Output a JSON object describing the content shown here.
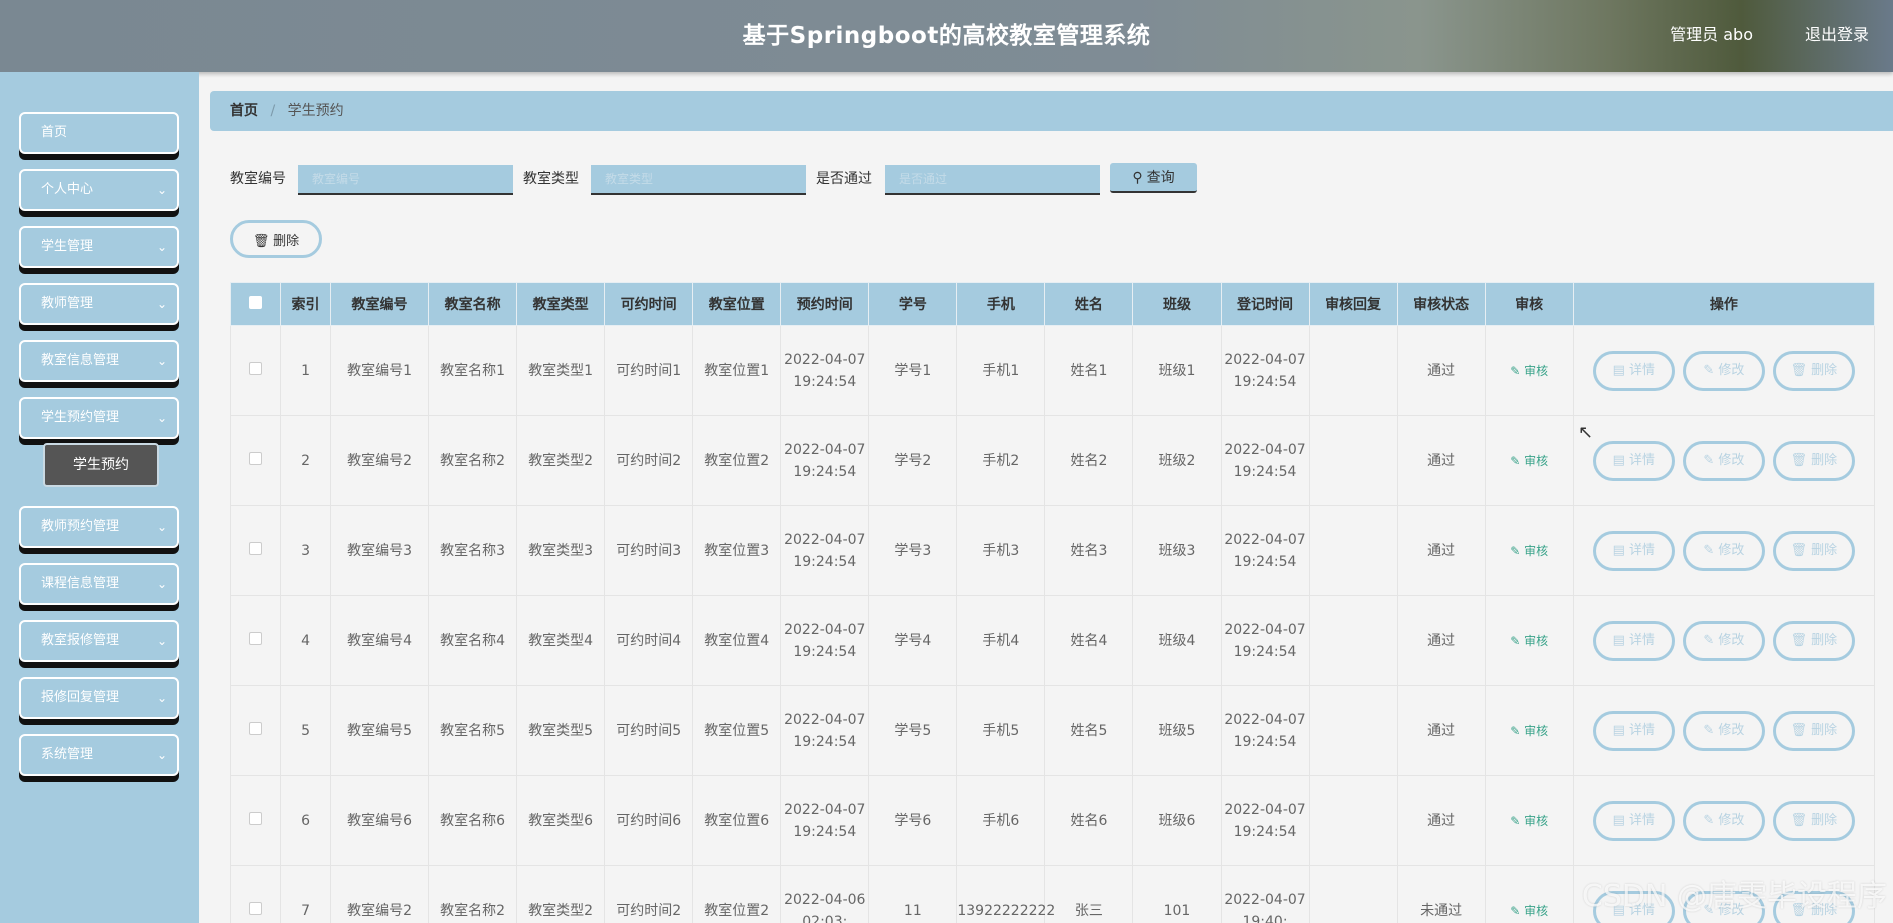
{
  "header": {
    "title": "基于Springboot的高校教室管理系统",
    "user": "管理员 abo",
    "logout": "退出登录"
  },
  "sidebar": {
    "items": [
      {
        "label": "首页",
        "has_chevron": false
      },
      {
        "label": "个人中心",
        "has_chevron": true
      },
      {
        "label": "学生管理",
        "has_chevron": true
      },
      {
        "label": "教师管理",
        "has_chevron": true
      },
      {
        "label": "教室信息管理",
        "has_chevron": true
      },
      {
        "label": "学生预约管理",
        "has_chevron": true
      },
      {
        "label": "教师预约管理",
        "has_chevron": true
      },
      {
        "label": "课程信息管理",
        "has_chevron": true
      },
      {
        "label": "教室报修管理",
        "has_chevron": true
      },
      {
        "label": "报修回复管理",
        "has_chevron": true
      },
      {
        "label": "系统管理",
        "has_chevron": true
      }
    ],
    "sub_item": "学生预约"
  },
  "breadcrumb": {
    "home": "首页",
    "current": "学生预约"
  },
  "search": {
    "field1_label": "教室编号",
    "field1_placeholder": "教室编号",
    "field2_label": "教室类型",
    "field2_placeholder": "教室类型",
    "field3_label": "是否通过",
    "field3_placeholder": "是否通过",
    "button": "查询"
  },
  "delete_button": "删除",
  "table": {
    "headers": [
      "",
      "索引",
      "教室编号",
      "教室名称",
      "教室类型",
      "可约时间",
      "教室位置",
      "预约时间",
      "学号",
      "手机",
      "姓名",
      "班级",
      "登记时间",
      "审核回复",
      "审核状态",
      "审核",
      "操作"
    ],
    "audit_label": "审核",
    "op_labels": {
      "detail": "详情",
      "edit": "修改",
      "delete": "删除"
    },
    "rows": [
      {
        "index": "1",
        "room_no": "教室编号1",
        "room_name": "教室名称1",
        "room_type": "教室类型1",
        "avail": "可约时间1",
        "location": "教室位置1",
        "book_time": "2022-04-07 19:24:54",
        "student_no": "学号1",
        "phone": "手机1",
        "name": "姓名1",
        "class": "班级1",
        "reg_time": "2022-04-07 19:24:54",
        "reply": "",
        "status": "通过"
      },
      {
        "index": "2",
        "room_no": "教室编号2",
        "room_name": "教室名称2",
        "room_type": "教室类型2",
        "avail": "可约时间2",
        "location": "教室位置2",
        "book_time": "2022-04-07 19:24:54",
        "student_no": "学号2",
        "phone": "手机2",
        "name": "姓名2",
        "class": "班级2",
        "reg_time": "2022-04-07 19:24:54",
        "reply": "",
        "status": "通过"
      },
      {
        "index": "3",
        "room_no": "教室编号3",
        "room_name": "教室名称3",
        "room_type": "教室类型3",
        "avail": "可约时间3",
        "location": "教室位置3",
        "book_time": "2022-04-07 19:24:54",
        "student_no": "学号3",
        "phone": "手机3",
        "name": "姓名3",
        "class": "班级3",
        "reg_time": "2022-04-07 19:24:54",
        "reply": "",
        "status": "通过"
      },
      {
        "index": "4",
        "room_no": "教室编号4",
        "room_name": "教室名称4",
        "room_type": "教室类型4",
        "avail": "可约时间4",
        "location": "教室位置4",
        "book_time": "2022-04-07 19:24:54",
        "student_no": "学号4",
        "phone": "手机4",
        "name": "姓名4",
        "class": "班级4",
        "reg_time": "2022-04-07 19:24:54",
        "reply": "",
        "status": "通过"
      },
      {
        "index": "5",
        "room_no": "教室编号5",
        "room_name": "教室名称5",
        "room_type": "教室类型5",
        "avail": "可约时间5",
        "location": "教室位置5",
        "book_time": "2022-04-07 19:24:54",
        "student_no": "学号5",
        "phone": "手机5",
        "name": "姓名5",
        "class": "班级5",
        "reg_time": "2022-04-07 19:24:54",
        "reply": "",
        "status": "通过"
      },
      {
        "index": "6",
        "room_no": "教室编号6",
        "room_name": "教室名称6",
        "room_type": "教室类型6",
        "avail": "可约时间6",
        "location": "教室位置6",
        "book_time": "2022-04-07 19:24:54",
        "student_no": "学号6",
        "phone": "手机6",
        "name": "姓名6",
        "class": "班级6",
        "reg_time": "2022-04-07 19:24:54",
        "reply": "",
        "status": "通过"
      },
      {
        "index": "7",
        "room_no": "教室编号2",
        "room_name": "教室名称2",
        "room_type": "教室类型2",
        "avail": "可约时间2",
        "location": "教室位置2",
        "book_time": "2022-04-06 02:03:",
        "student_no": "11",
        "phone": "13922222222",
        "name": "张三",
        "class": "101",
        "reg_time": "2022-04-07 19:40:",
        "reply": "",
        "status": "未通过"
      }
    ]
  },
  "watermark": "CSDN @唐雯毕设程序"
}
